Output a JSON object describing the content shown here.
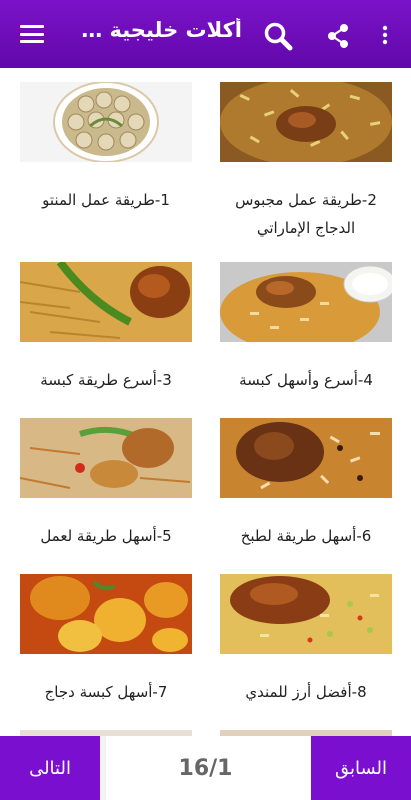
{
  "appbar": {
    "title": "أكلات خليجية ال...",
    "icons": [
      "menu-icon",
      "search-icon",
      "share-icon",
      "more-vert-icon"
    ],
    "color": "#6a0dad"
  },
  "recipes": [
    {
      "caption": "1-طريقة عمل المنتو",
      "image": "dumplings-dish"
    },
    {
      "caption": "2-طريقة عمل مجبوس الدجاج الإماراتي",
      "image": "chicken-majboos"
    },
    {
      "caption": "3-أسرع طريقة كبسة",
      "image": "chicken-kabsa"
    },
    {
      "caption": "4-أسرع وأسهل كبسة",
      "image": "kabsa-with-yogurt"
    },
    {
      "caption": "5-أسهل طريقة لعمل",
      "image": "rice-chicken"
    },
    {
      "caption": "6-أسهل طريقة لطبخ",
      "image": "meat-rice"
    },
    {
      "caption": "7-أسهل كبسة دجاج",
      "image": "chicken-potatoes"
    },
    {
      "caption": "8-أفضل أرز للمندي",
      "image": "mandi-rice"
    }
  ],
  "pager": {
    "next_label": "التالى",
    "page_indicator": "16/1",
    "prev_label": "السابق",
    "button_color": "#7a0fd0"
  }
}
